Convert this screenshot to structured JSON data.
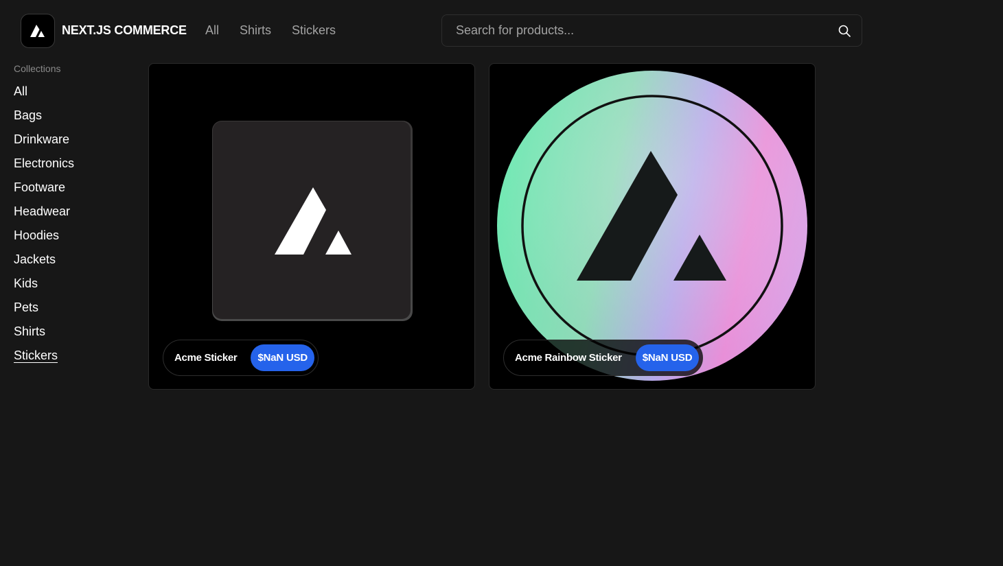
{
  "header": {
    "brand": "NEXT.JS COMMERCE",
    "logo_icon": "acme-logo-icon",
    "nav": [
      {
        "label": "All"
      },
      {
        "label": "Shirts"
      },
      {
        "label": "Stickers"
      }
    ],
    "search": {
      "placeholder": "Search for products...",
      "value": "",
      "icon": "search-icon"
    }
  },
  "sidebar": {
    "heading": "Collections",
    "items": [
      {
        "label": "All"
      },
      {
        "label": "Bags"
      },
      {
        "label": "Drinkware"
      },
      {
        "label": "Electronics"
      },
      {
        "label": "Footware"
      },
      {
        "label": "Headwear"
      },
      {
        "label": "Hoodies"
      },
      {
        "label": "Jackets"
      },
      {
        "label": "Kids"
      },
      {
        "label": "Pets"
      },
      {
        "label": "Shirts"
      },
      {
        "label": "Stickers",
        "active": true
      }
    ]
  },
  "products": [
    {
      "title": "Acme Sticker",
      "price": "$NaN USD",
      "image_icon": "acme-sticker-image"
    },
    {
      "title": "Acme Rainbow Sticker",
      "price": "$NaN USD",
      "image_icon": "acme-rainbow-sticker-image"
    }
  ],
  "colors": {
    "background": "#171717",
    "card_background": "#000000",
    "price_badge": "#2563eb",
    "muted_text": "#a3a3a3"
  }
}
